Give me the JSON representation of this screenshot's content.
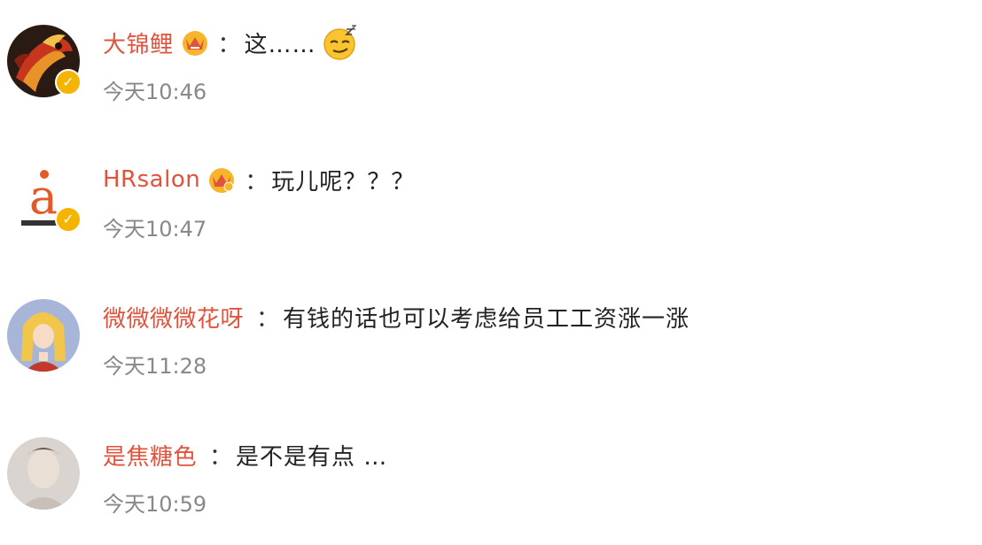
{
  "comments": [
    {
      "username": "大锦鲤",
      "separator": "：",
      "text": "这……",
      "time": "今天10:46",
      "has_badge": true,
      "emoji": "smirk-face-emoji"
    },
    {
      "username": "HRsalon",
      "separator": "：",
      "text": "玩儿呢？？？",
      "time": "今天10:47",
      "has_badge": true
    },
    {
      "username": "微微微微花呀",
      "separator": "：",
      "text": "有钱的话也可以考虑给员工工资涨一涨",
      "time": "今天11:28",
      "has_badge": false
    },
    {
      "username": "是焦糖色",
      "separator": "：",
      "text": "是不是有点 …",
      "time": "今天10:59",
      "has_badge": false
    }
  ],
  "colors": {
    "username": "#e0533d",
    "text": "#222222",
    "time": "#888888",
    "verified_badge": "#f5b400"
  }
}
